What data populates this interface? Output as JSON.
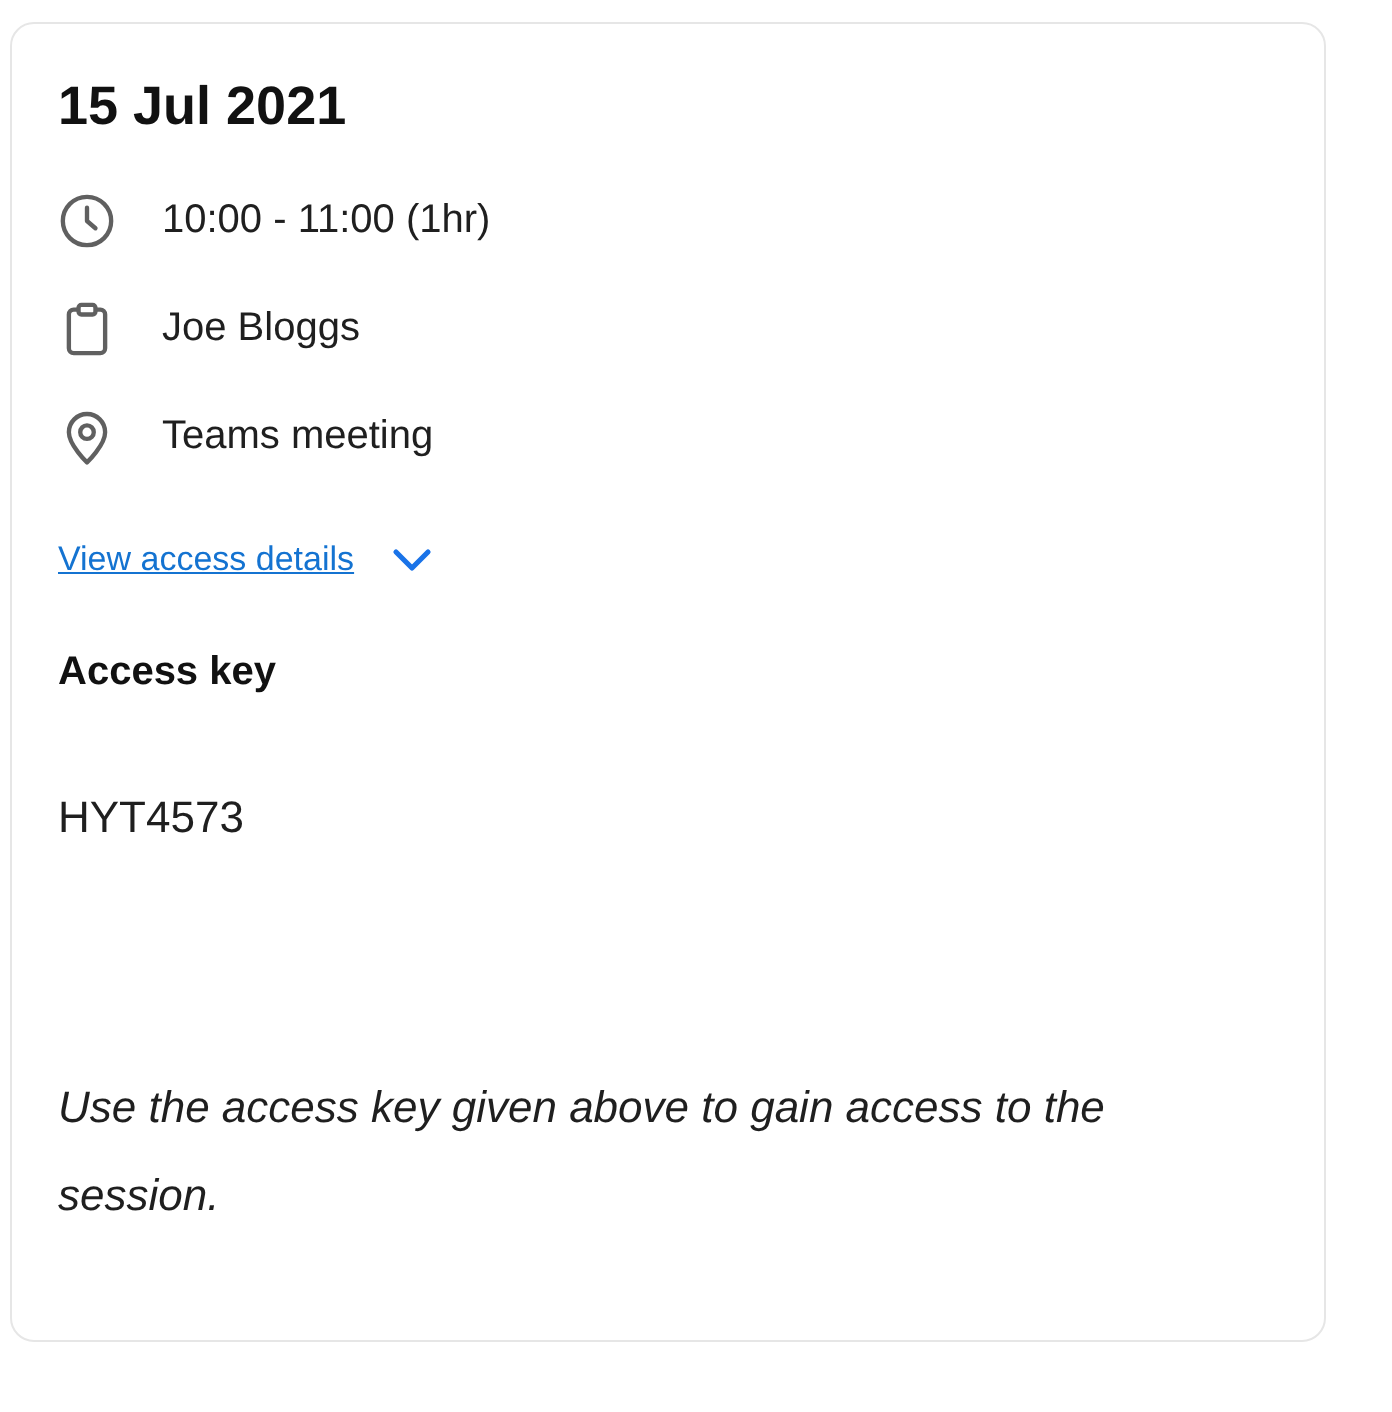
{
  "date": "15 Jul 2021",
  "details": [
    {
      "kind": "time",
      "text": "10:00 - 11:00 (1hr)"
    },
    {
      "kind": "host",
      "text": "Joe Bloggs"
    },
    {
      "kind": "location",
      "text": "Teams meeting"
    }
  ],
  "access_link": "View access details",
  "access": {
    "heading": "Access key",
    "key": "HYT4573",
    "note": "Use the access key given above to gain access to the session."
  }
}
